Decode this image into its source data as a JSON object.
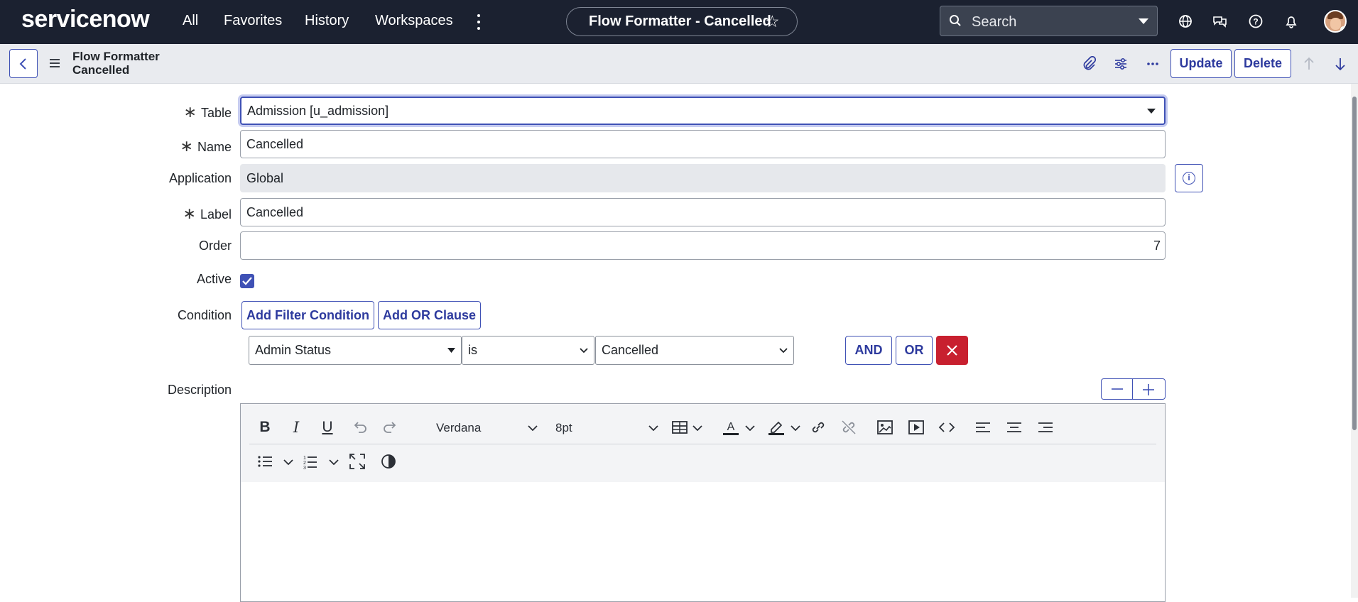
{
  "header": {
    "logo": "servicenow",
    "nav": [
      "All",
      "Favorites",
      "History",
      "Workspaces"
    ],
    "record_title": "Flow Formatter - Cancelled",
    "search_placeholder": "Search"
  },
  "form_header": {
    "title_line1": "Flow Formatter",
    "title_line2": "Cancelled",
    "update_label": "Update",
    "delete_label": "Delete"
  },
  "form": {
    "table_label": "Table",
    "table_value": "Admission [u_admission]",
    "name_label": "Name",
    "name_value": "Cancelled",
    "application_label": "Application",
    "application_value": "Global",
    "label_label": "Label",
    "label_value": "Cancelled",
    "order_label": "Order",
    "order_value": "7",
    "active_label": "Active",
    "active_checked": true,
    "condition_label": "Condition",
    "add_filter_label": "Add Filter Condition",
    "add_or_label": "Add OR Clause",
    "condition_field": "Admin Status",
    "condition_operator": "is",
    "condition_value": "Cancelled",
    "and_label": "AND",
    "or_label": "OR",
    "description_label": "Description"
  },
  "editor": {
    "font_family": "Verdana",
    "font_size": "8pt"
  },
  "colors": {
    "header_bg": "#1b2130",
    "accent": "#3f51b5",
    "danger": "#c8202f"
  }
}
